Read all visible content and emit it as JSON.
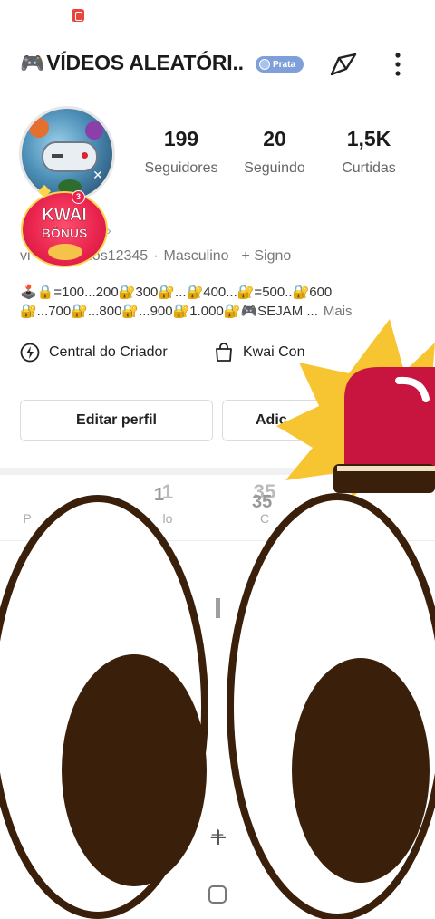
{
  "header": {
    "title": "VÍDEOS ALEATÓRI..",
    "title_icon": "game-controller-emoji",
    "badge": "Prata",
    "share_icon": "share-arrow-icon",
    "more_icon": "more-vertical-icon"
  },
  "profile": {
    "stats": [
      {
        "value": "199",
        "label": "Seguidores"
      },
      {
        "value": "20",
        "label": "Seguindo"
      },
      {
        "value": "1,5K",
        "label": "Curtidas"
      }
    ],
    "id_visible": "torios12345",
    "id_prefix": "vi",
    "gender": "Masculino",
    "sign": "+ Signo",
    "bio_line1": "🕹️🔒=100...200🔐300🔐...🔐400...🔐=500..🔐600",
    "bio_line2": "🔐...700🔐...800🔐...900🔐1.000🔐🎮SEJAM ...",
    "bio_more": "Mais"
  },
  "bonus": {
    "title": "KWAI",
    "subtitle": "BÔNUS",
    "count": "3"
  },
  "creator": {
    "central": "Central do Criador",
    "kwai": "Kwai Con"
  },
  "buttons": {
    "edit": "Editar perfil",
    "add": "Adic"
  },
  "tabs": [
    {
      "num": "",
      "label": "P"
    },
    {
      "num": "1",
      "label": "lo"
    },
    {
      "num": "35",
      "label": "C"
    }
  ],
  "colors": {
    "badge": "#7f9fd8",
    "bonus_red": "#e8234d",
    "siren_red": "#c7153f",
    "starburst_yellow": "#f7c531",
    "eye_pupil": "#3a1f0a"
  }
}
